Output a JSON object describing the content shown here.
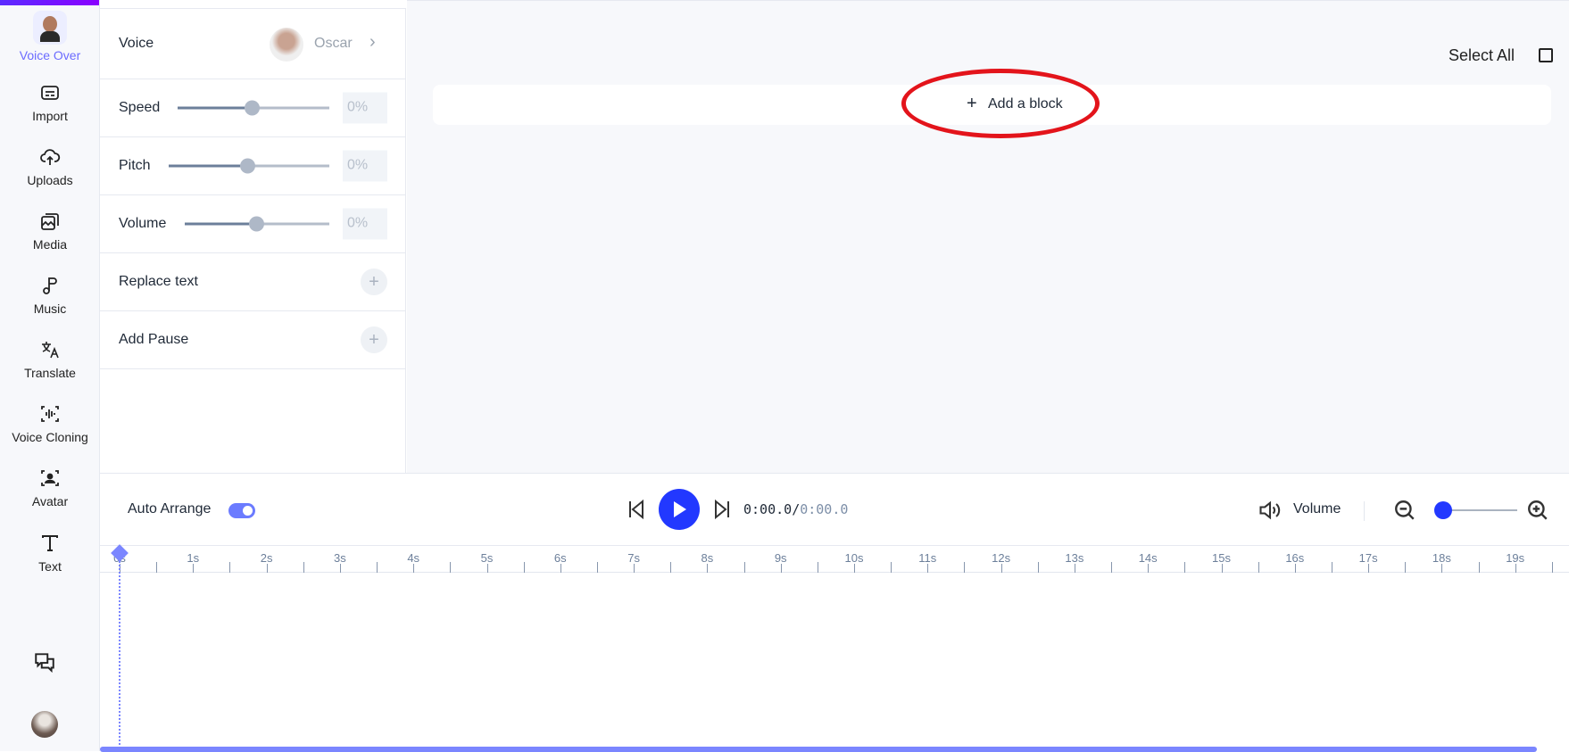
{
  "sidebar": {
    "items": [
      {
        "label": "Voice Over",
        "icon": "voice-over-avatar",
        "active": true
      },
      {
        "label": "Import",
        "icon": "import-icon"
      },
      {
        "label": "Uploads",
        "icon": "cloud-upload-icon"
      },
      {
        "label": "Media",
        "icon": "media-icon"
      },
      {
        "label": "Music",
        "icon": "music-note-icon"
      },
      {
        "label": "Translate",
        "icon": "translate-icon"
      },
      {
        "label": "Voice Cloning",
        "icon": "voice-cloning-icon"
      },
      {
        "label": "Avatar",
        "icon": "avatar-icon"
      },
      {
        "label": "Text",
        "icon": "text-icon"
      }
    ],
    "bottom": {
      "chat_icon": "chat-icon",
      "user_avatar": "user-avatar"
    },
    "accent": "#6b6bff"
  },
  "panel": {
    "voice": {
      "label": "Voice",
      "name": "Oscar"
    },
    "speed": {
      "label": "Speed",
      "value": "0%",
      "level": 0.5
    },
    "pitch": {
      "label": "Pitch",
      "value": "0%",
      "level": 0.5
    },
    "volume": {
      "label": "Volume",
      "value": "0%",
      "level": 0.5
    },
    "replace_text": {
      "label": "Replace text"
    },
    "add_pause": {
      "label": "Add Pause"
    }
  },
  "main": {
    "select_all": "Select All",
    "add_block": "Add a block",
    "add_block_plus": "+",
    "highlight_color": "#e3141b"
  },
  "timeline": {
    "auto_arrange": {
      "label": "Auto Arrange",
      "on": true
    },
    "current_time": "0:00.0",
    "separator": "/",
    "total_time": "0:00.0",
    "volume_label": "Volume",
    "zoom_level": 0,
    "ruler": [
      "0s",
      "1s",
      "2s",
      "3s",
      "4s",
      "5s",
      "6s",
      "7s",
      "8s",
      "9s",
      "10s",
      "11s",
      "12s",
      "13s",
      "14s",
      "15s",
      "16s",
      "17s",
      "18s",
      "19s"
    ],
    "play_color": "#2238ff"
  }
}
